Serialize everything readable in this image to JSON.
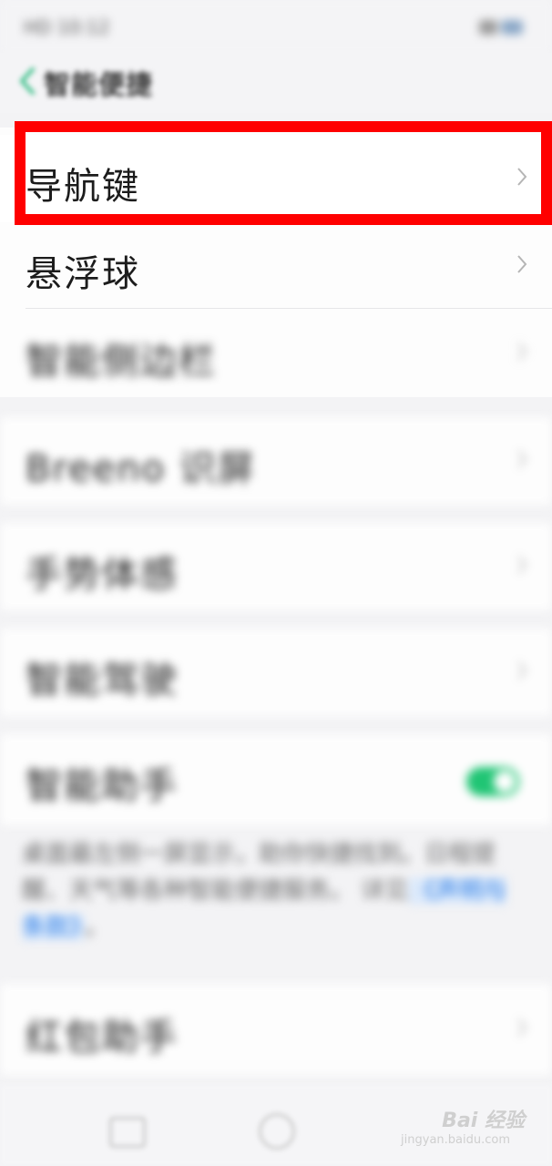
{
  "status_bar": {
    "time": "HD 10:12",
    "signal_icon": "signal-icon",
    "battery_icon": "battery-icon"
  },
  "header": {
    "back_icon": "chevron-left-icon",
    "title": "智能便捷"
  },
  "items": [
    {
      "label": "导航键"
    },
    {
      "label": "悬浮球"
    },
    {
      "label": "智能侧边栏"
    },
    {
      "label": "Breeno 识屏"
    },
    {
      "label": "手势体感"
    },
    {
      "label": "智能驾驶"
    },
    {
      "label": "智能助手"
    },
    {
      "label": "红包助手"
    }
  ],
  "assistant_toggle": {
    "state": "on"
  },
  "description": {
    "text": "桌面最左侧一屏显示，助你快捷找到。日程提醒、天气等各种智能便捷服务。",
    "prefix": "详见",
    "link": "《声明与条款》",
    "suffix": "。"
  },
  "nav_bar": {
    "recents_icon": "recents-square-icon",
    "home_icon": "home-circle-icon"
  },
  "watermark": {
    "text": "Bai 经验",
    "sub": "jingyan.baidu.com"
  },
  "colors": {
    "highlight": "#ff0000",
    "toggle_on": "#20c574",
    "accent_link": "#2f7fe6",
    "back_arrow": "#3cc08a"
  }
}
